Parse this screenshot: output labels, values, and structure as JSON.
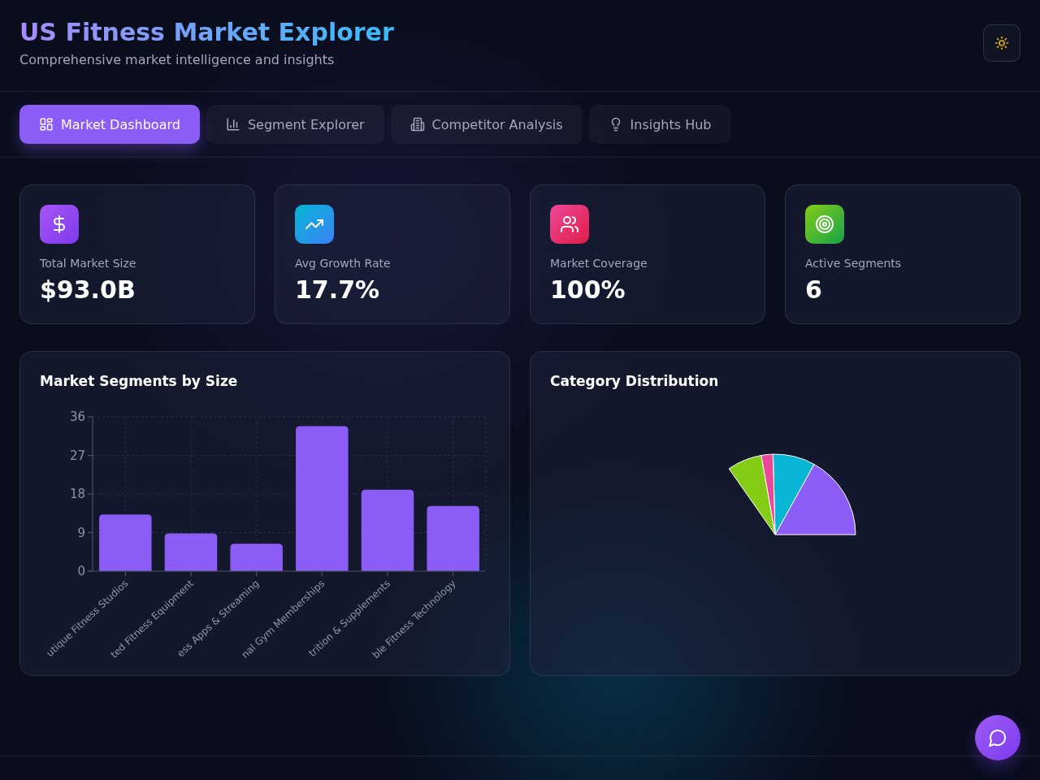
{
  "header": {
    "title": "US Fitness Market Explorer",
    "subtitle": "Comprehensive market intelligence and insights"
  },
  "tabs": [
    {
      "label": "Market Dashboard",
      "selected": true
    },
    {
      "label": "Segment Explorer",
      "selected": false
    },
    {
      "label": "Competitor Analysis",
      "selected": false
    },
    {
      "label": "Insights Hub",
      "selected": false
    }
  ],
  "stats": [
    {
      "label": "Total Market Size",
      "value": "$93.0B"
    },
    {
      "label": "Avg Growth Rate",
      "value": "17.7%"
    },
    {
      "label": "Market Coverage",
      "value": "100%"
    },
    {
      "label": "Active Segments",
      "value": "6"
    }
  ],
  "segments_chart": {
    "title": "Market Segments by Size",
    "chart_data": {
      "type": "bar",
      "categories": [
        "utique Fitness Studios",
        "ted Fitness Equipment",
        "ess Apps & Streaming",
        "nal Gym Memberships",
        "trition & Supplements",
        "ble Fitness Technology"
      ],
      "values": [
        13.2,
        8.8,
        6.4,
        33.8,
        19.0,
        15.2
      ],
      "color": "#8b5cf6",
      "ylim": [
        0,
        36
      ],
      "yticks": [
        0,
        9,
        18,
        27,
        36
      ],
      "grid": true
    }
  },
  "category_chart": {
    "title": "Category Distribution"
  }
}
